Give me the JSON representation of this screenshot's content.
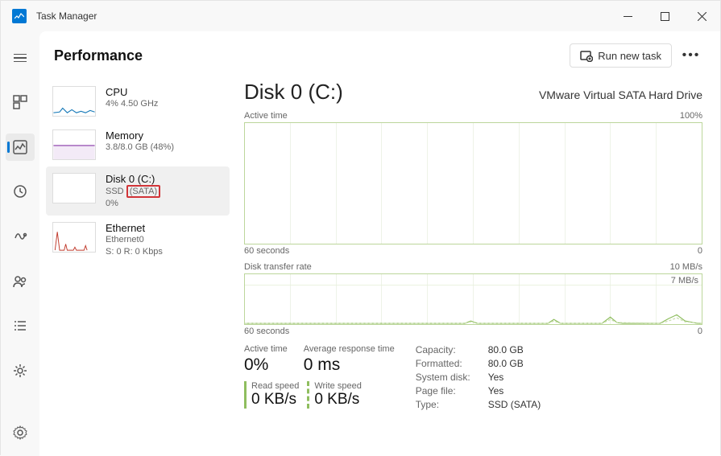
{
  "app": {
    "title": "Task Manager"
  },
  "window_controls": {
    "minimize": "minimize",
    "maximize": "maximize",
    "close": "close"
  },
  "rail": {
    "items": [
      "menu",
      "processes",
      "performance",
      "history",
      "startup",
      "users",
      "details",
      "services"
    ],
    "active": "performance",
    "settings": "settings"
  },
  "header": {
    "title": "Performance",
    "run_new_task": "Run new task",
    "more": "more-options"
  },
  "categories": [
    {
      "id": "cpu",
      "title": "CPU",
      "sub1": "4% 4.50 GHz"
    },
    {
      "id": "memory",
      "title": "Memory",
      "sub1": "3.8/8.0 GB (48%)"
    },
    {
      "id": "disk",
      "title": "Disk 0 (C:)",
      "sub1_prefix": "SSD ",
      "sub1_highlight": "(SATA)",
      "sub2": "0%"
    },
    {
      "id": "ethernet",
      "title": "Ethernet",
      "sub1": "Ethernet0",
      "sub2": "S: 0 R: 0 Kbps"
    }
  ],
  "detail": {
    "title": "Disk 0 (C:)",
    "description": "VMware Virtual SATA Hard Drive",
    "chart1": {
      "label": "Active time",
      "max": "100%",
      "x_left": "60 seconds",
      "x_right": "0"
    },
    "chart2": {
      "label": "Disk transfer rate",
      "max": "10 MB/s",
      "inner_label": "7 MB/s",
      "x_left": "60 seconds",
      "x_right": "0"
    },
    "stats": {
      "active_time": {
        "label": "Active time",
        "value": "0%"
      },
      "avg_response": {
        "label": "Average response time",
        "value": "0 ms"
      },
      "read_speed": {
        "label": "Read speed",
        "value": "0 KB/s"
      },
      "write_speed": {
        "label": "Write speed",
        "value": "0 KB/s"
      }
    },
    "info": {
      "capacity_k": "Capacity:",
      "capacity_v": "80.0 GB",
      "formatted_k": "Formatted:",
      "formatted_v": "80.0 GB",
      "system_disk_k": "System disk:",
      "system_disk_v": "Yes",
      "page_file_k": "Page file:",
      "page_file_v": "Yes",
      "type_k": "Type:",
      "type_v": "SSD (SATA)"
    }
  },
  "chart_data": [
    {
      "type": "line",
      "title": "Active time",
      "ylabel": "%",
      "ylim": [
        0,
        100
      ],
      "xlabel": "seconds",
      "x_range": [
        60,
        0
      ],
      "values": [
        0,
        0,
        0,
        0,
        0,
        0,
        0,
        0,
        0,
        0,
        0,
        0,
        0,
        0,
        0,
        0,
        0,
        0,
        0,
        0,
        0,
        0,
        0,
        0,
        0,
        0,
        0,
        0,
        0,
        0,
        0,
        0,
        0,
        0,
        0,
        0,
        0,
        0,
        0,
        0,
        0,
        0,
        0,
        0,
        0,
        0,
        0,
        0,
        0,
        0,
        0,
        0,
        0,
        0,
        0,
        0,
        0,
        0,
        0,
        0
      ]
    },
    {
      "type": "line",
      "title": "Disk transfer rate",
      "ylabel": "MB/s",
      "ylim": [
        0,
        10
      ],
      "xlabel": "seconds",
      "x_range": [
        60,
        0
      ],
      "series": [
        {
          "name": "Read",
          "values": [
            0,
            0,
            0,
            0,
            0,
            0,
            0,
            0,
            0,
            0,
            0,
            0,
            0,
            0,
            0,
            0,
            0,
            0,
            0,
            0,
            0,
            0,
            0,
            0,
            0,
            0,
            0,
            0,
            0,
            0,
            0.5,
            0,
            0,
            0,
            0,
            0,
            0,
            0,
            0,
            0,
            0.8,
            0,
            0,
            0,
            0,
            0,
            0,
            0,
            1.0,
            0.2,
            0,
            0,
            0,
            0,
            0,
            0.6,
            1.2,
            0.3,
            0,
            0
          ]
        },
        {
          "name": "Write",
          "values": [
            0,
            0,
            0,
            0,
            0,
            0,
            0,
            0,
            0,
            0,
            0,
            0,
            0,
            0,
            0,
            0,
            0,
            0,
            0,
            0,
            0,
            0,
            0,
            0,
            0,
            0,
            0,
            0,
            0,
            0,
            0.3,
            0,
            0,
            0,
            0,
            0,
            0,
            0,
            0,
            0,
            0.5,
            0,
            0,
            0,
            0,
            0,
            0,
            0,
            0.6,
            0.1,
            0,
            0,
            0,
            0,
            0,
            0.4,
            0.8,
            0.2,
            0,
            0
          ]
        }
      ]
    }
  ]
}
